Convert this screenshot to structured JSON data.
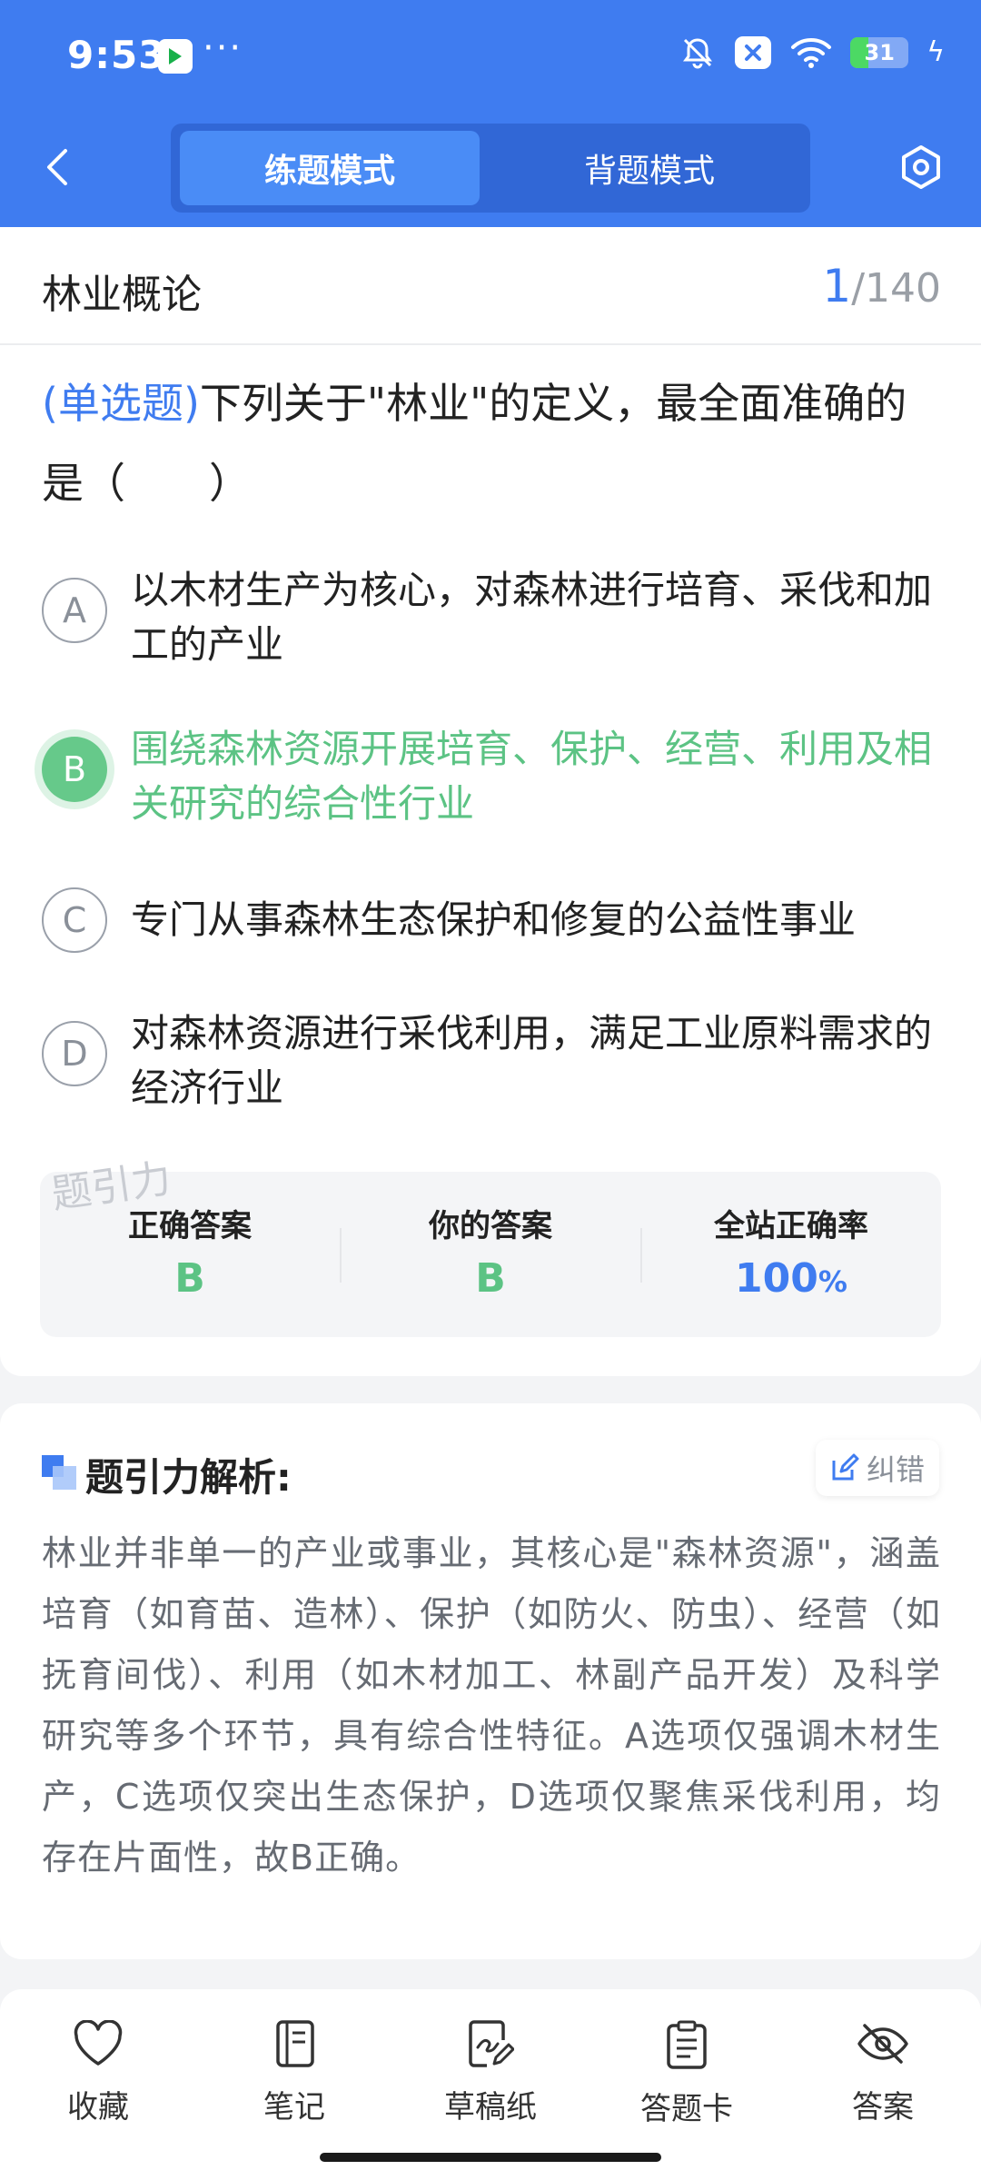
{
  "status_bar": {
    "time": "9:53",
    "dots": "···",
    "battery": "31",
    "battery_level": 0.31
  },
  "header": {
    "tabs": [
      {
        "label": "练题模式",
        "active": true
      },
      {
        "label": "背题模式",
        "active": false
      }
    ]
  },
  "subject": {
    "title": "林业概论",
    "current": "1",
    "total": "/140"
  },
  "question": {
    "type": "(单选题)",
    "text": "下列关于\"林业\"的定义，最全面准确的是（　　）"
  },
  "options": [
    {
      "letter": "A",
      "text": "以木材生产为核心，对森林进行培育、采伐和加工的产业"
    },
    {
      "letter": "B",
      "text": "围绕森林资源开展培育、保护、经营、利用及相关研究的综合性行业"
    },
    {
      "letter": "C",
      "text": "专门从事森林生态保护和修复的公益性事业"
    },
    {
      "letter": "D",
      "text": "对森林资源进行采伐利用，满足工业原料需求的经济行业"
    }
  ],
  "watermark": "题引力",
  "answer_panel": {
    "correct_label": "正确答案",
    "correct_value": "B",
    "yours_label": "你的答案",
    "yours_value": "B",
    "rate_label": "全站正确率",
    "rate_value": "100",
    "rate_unit": "%"
  },
  "analysis": {
    "title": "题引力解析:",
    "correction": "纠错",
    "body": "林业并非单一的产业或事业，其核心是\"森林资源\"，涵盖培育（如育苗、造林）、保护（如防火、防虫）、经营（如抚育间伐）、利用（如木材加工、林副产品开发）及科学研究等多个环节，具有综合性特征。A选项仅强调木材生产，C选项仅突出生态保护，D选项仅聚焦采伐利用，均存在片面性，故B正确。"
  },
  "bottom_nav": [
    {
      "label": "收藏",
      "icon": "heart-icon"
    },
    {
      "label": "笔记",
      "icon": "notebook-icon"
    },
    {
      "label": "草稿纸",
      "icon": "scratch-paper-icon"
    },
    {
      "label": "答题卡",
      "icon": "clipboard-icon"
    },
    {
      "label": "答案",
      "icon": "eye-off-icon"
    }
  ],
  "colors": {
    "primary": "#3F7CF0",
    "correct": "#5CC384"
  }
}
